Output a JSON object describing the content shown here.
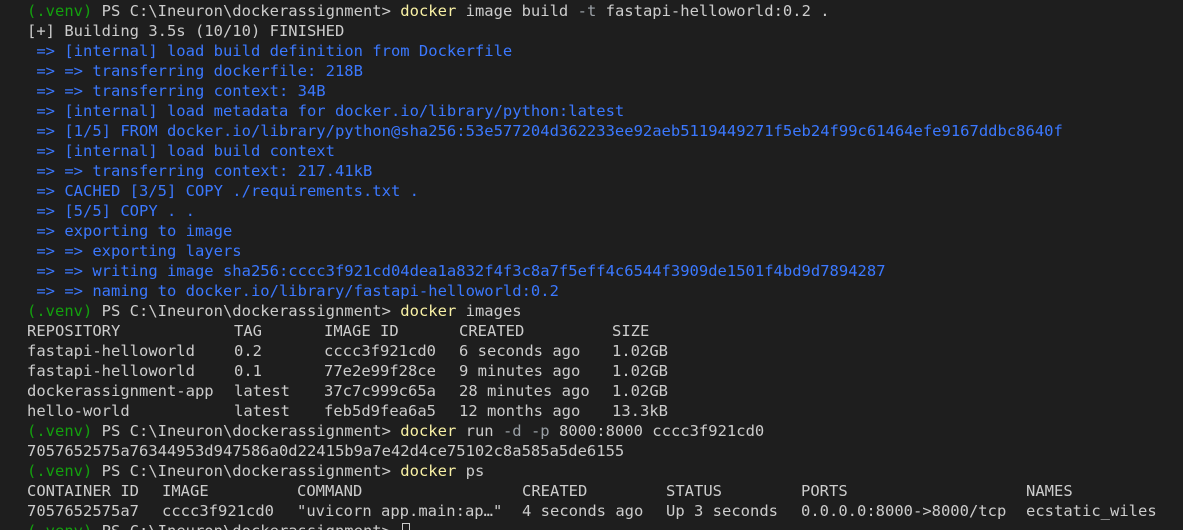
{
  "colors": {
    "background": "#1e1e1e",
    "text": "#cccccc",
    "prompt_venv": "#13a10e",
    "command": "#f9f1a5",
    "flag": "#9aa0a6",
    "build_step": "#3b78ff"
  },
  "prompt": {
    "venv": "(.venv)",
    "path": " PS C:\\Ineuron\\dockerassignment> "
  },
  "cmd1": {
    "name": "docker",
    "arg1": " image build ",
    "flag": "-t",
    "arg2": " fastapi-helloworld:0.2 ."
  },
  "build": {
    "header": "[+] Building 3.5s (10/10) FINISHED",
    "steps": [
      " => [internal] load build definition from Dockerfile",
      " => => transferring dockerfile: 218B",
      " => => transferring context: 34B",
      " => [internal] load metadata for docker.io/library/python:latest",
      " => [1/5] FROM docker.io/library/python@sha256:53e577204d362233ee92aeb5119449271f5eb24f99c61464efe9167ddbc8640f",
      " => [internal] load build context",
      " => => transferring context: 217.41kB",
      " => CACHED [3/5] COPY ./requirements.txt .",
      " => [5/5] COPY . .",
      " => exporting to image",
      " => => exporting layers",
      " => => writing image sha256:cccc3f921cd04dea1a832f4f3c8a7f5eff4c6544f3909de1501f4bd9d7894287",
      " => => naming to docker.io/library/fastapi-helloworld:0.2"
    ]
  },
  "cmd2": {
    "name": "docker",
    "arg": " images"
  },
  "images": {
    "headers": [
      "REPOSITORY",
      "TAG",
      "IMAGE ID",
      "CREATED",
      "SIZE"
    ],
    "rows": [
      [
        "fastapi-helloworld",
        "0.2",
        "cccc3f921cd0",
        "6 seconds ago",
        "1.02GB"
      ],
      [
        "fastapi-helloworld",
        "0.1",
        "77e2e99f28ce",
        "9 minutes ago",
        "1.02GB"
      ],
      [
        "dockerassignment-app",
        "latest",
        "37c7c999c65a",
        "28 minutes ago",
        "1.02GB"
      ],
      [
        "hello-world",
        "latest",
        "feb5d9fea6a5",
        "12 months ago",
        "13.3kB"
      ]
    ]
  },
  "cmd3": {
    "name": "docker",
    "arg1": " run ",
    "flags": "-d -p",
    "arg2": " 8000:8000 cccc3f921cd0"
  },
  "run_output": "7057652575a76344953d947586a0d22415b9a7e42d4ce75102c8a585a5de6155",
  "cmd4": {
    "name": "docker",
    "arg": " ps"
  },
  "ps": {
    "headers": [
      "CONTAINER ID",
      "IMAGE",
      "COMMAND",
      "CREATED",
      "STATUS",
      "PORTS",
      "NAMES"
    ],
    "rows": [
      [
        "7057652575a7",
        "cccc3f921cd0",
        "\"uvicorn app.main:ap…\"",
        "4 seconds ago",
        "Up 3 seconds",
        "0.0.0.0:8000->8000/tcp",
        "ecstatic_wiles"
      ]
    ]
  }
}
